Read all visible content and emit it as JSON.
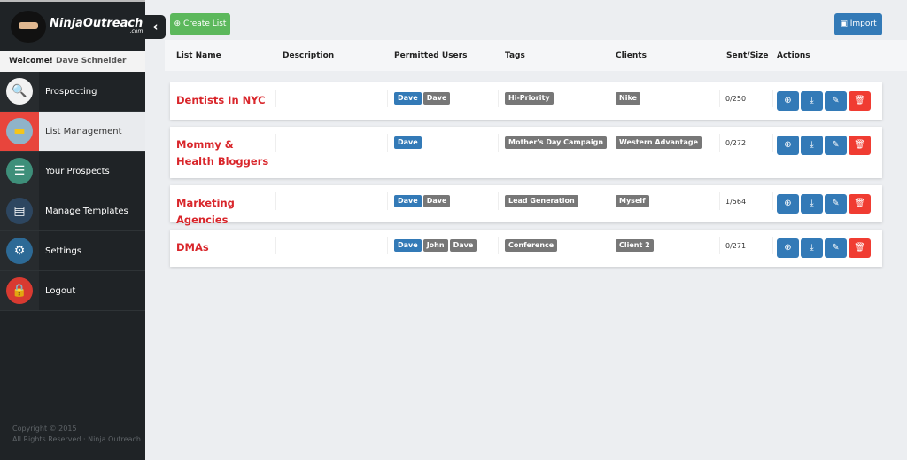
{
  "brand": {
    "name": "NinjaOutreach",
    "sub": ".com"
  },
  "welcome": {
    "prefix": "Welcome!",
    "user": "Dave Schneider"
  },
  "nav": [
    {
      "label": "Prospecting",
      "icon": "magnifier-icon",
      "color": "#f2f2f2",
      "active": false
    },
    {
      "label": "List Management",
      "icon": "folder-icon",
      "color": "#8fb3c9",
      "active": true
    },
    {
      "label": "Your Prospects",
      "icon": "list-icon",
      "color": "#3e8f7a",
      "active": false
    },
    {
      "label": "Manage Templates",
      "icon": "template-icon",
      "color": "#2d4660",
      "active": false
    },
    {
      "label": "Settings",
      "icon": "gear-icon",
      "color": "#2d6a96",
      "active": false
    },
    {
      "label": "Logout",
      "icon": "lock-icon",
      "color": "#d83a31",
      "active": false
    }
  ],
  "copyright": {
    "line1": "Copyright © 2015",
    "line2": "All Rights Reserved · Ninja Outreach"
  },
  "toolbar": {
    "create": "Create List",
    "import": "Import"
  },
  "columns": [
    "List Name",
    "Description",
    "Permitted Users",
    "Tags",
    "Clients",
    "Sent/Size",
    "Actions"
  ],
  "rows": [
    {
      "name": "Dentists In NYC",
      "description": "",
      "users": [
        {
          "n": "Dave",
          "c": "blue"
        },
        {
          "n": "Dave",
          "c": "gray"
        }
      ],
      "tags": [
        "Hi-Priority"
      ],
      "clients": [
        "Nike"
      ],
      "sent": "0/250"
    },
    {
      "name": "Mommy & Health Bloggers",
      "description": "",
      "users": [
        {
          "n": "Dave",
          "c": "blue"
        }
      ],
      "tags": [
        "Mother's Day Campaign"
      ],
      "clients": [
        "Western Advantage"
      ],
      "sent": "0/272"
    },
    {
      "name": "Marketing Agencies",
      "description": "",
      "users": [
        {
          "n": "Dave",
          "c": "blue"
        },
        {
          "n": "Dave",
          "c": "gray"
        }
      ],
      "tags": [
        "Lead Generation"
      ],
      "clients": [
        "Myself"
      ],
      "sent": "1/564"
    },
    {
      "name": "DMAs",
      "description": "",
      "users": [
        {
          "n": "Dave",
          "c": "blue"
        },
        {
          "n": "John",
          "c": "gray"
        },
        {
          "n": "Dave",
          "c": "gray"
        }
      ],
      "tags": [
        "Conference"
      ],
      "clients": [
        "Client 2"
      ],
      "sent": "0/271"
    }
  ],
  "colors": {
    "sidebar": "#1f2326",
    "accent_red": "#d9262b",
    "primary": "#337ab7",
    "success": "#5cb85c",
    "danger": "#f03c32"
  }
}
